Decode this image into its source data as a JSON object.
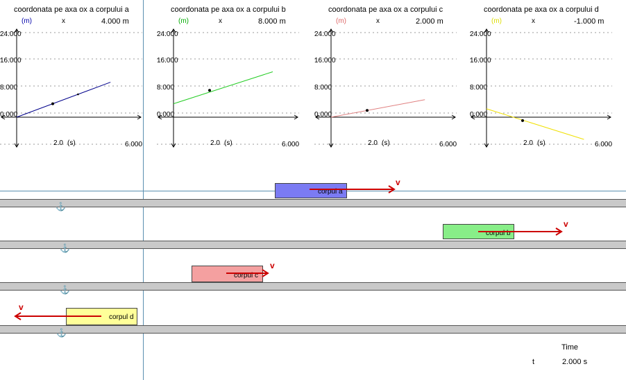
{
  "graphs": [
    {
      "title": "coordonata pe axa ox a corpului a",
      "unit": "(m)",
      "unit_color": "#0000aa",
      "x_symbol": "x",
      "value": "4.000 m",
      "y_ticks": [
        "24.000",
        "16.000",
        "8.000",
        "0.000"
      ],
      "x_tick": "2.0",
      "x_unit": "(s)",
      "x_max": "6.000",
      "line_color": "#00008b",
      "x_start": 0,
      "y_start": 0,
      "x_end": 5.2,
      "y_end": 10.4,
      "point_x": 2.0,
      "point_y": 4.0
    },
    {
      "title": "coordonata pe axa ox a corpului b",
      "unit": "(m)",
      "unit_color": "#00aa00",
      "x_symbol": "x",
      "value": "8.000 m",
      "y_ticks": [
        "24.000",
        "16.000",
        "8.000",
        "0.000"
      ],
      "x_tick": "2.0",
      "x_unit": "(s)",
      "x_max": "6.000",
      "line_color": "#22cc22",
      "x_start": 0,
      "y_start": 4.0,
      "x_end": 5.5,
      "y_end": 13.5,
      "point_x": 2.0,
      "point_y": 8.0
    },
    {
      "title": "coordonata pe axa ox a corpului c",
      "unit": "(m)",
      "unit_color": "#dd6666",
      "x_symbol": "x",
      "value": "2.000 m",
      "y_ticks": [
        "24.000",
        "16.000",
        "8.000",
        "0.000"
      ],
      "x_tick": "2.0",
      "x_unit": "(s)",
      "x_max": "6.000",
      "line_color": "#e08080",
      "x_start": 0,
      "y_start": 0,
      "x_end": 5.2,
      "y_end": 5.2,
      "point_x": 2.0,
      "point_y": 2.0
    },
    {
      "title": "coordonata pe axa ox a corpului d",
      "unit": "(m)",
      "unit_color": "#dddd00",
      "x_symbol": "x",
      "value": "-1.000 m",
      "y_ticks": [
        "24.000",
        "16.000",
        "8.000",
        "0.000"
      ],
      "x_tick": "2.0",
      "x_unit": "(s)",
      "x_max": "6.000",
      "line_color": "#f0e000",
      "x_start": 0,
      "y_start": 2.5,
      "x_end": 5.4,
      "y_end": -6.6,
      "point_x": 2.0,
      "point_y": -1.0
    }
  ],
  "bodies": [
    {
      "label": "corpul a",
      "color": "#7b7bf3",
      "vector_label": "v"
    },
    {
      "label": "corpul b",
      "color": "#88ee88",
      "vector_label": "v"
    },
    {
      "label": "corpul c",
      "color": "#f4a0a0",
      "vector_label": "v"
    },
    {
      "label": "corpul d",
      "color": "#ffff99",
      "vector_label": "v"
    }
  ],
  "anchor_icon": "anchor-icon",
  "time": {
    "title": "Time",
    "var": "t",
    "value": "2.000 s"
  }
}
